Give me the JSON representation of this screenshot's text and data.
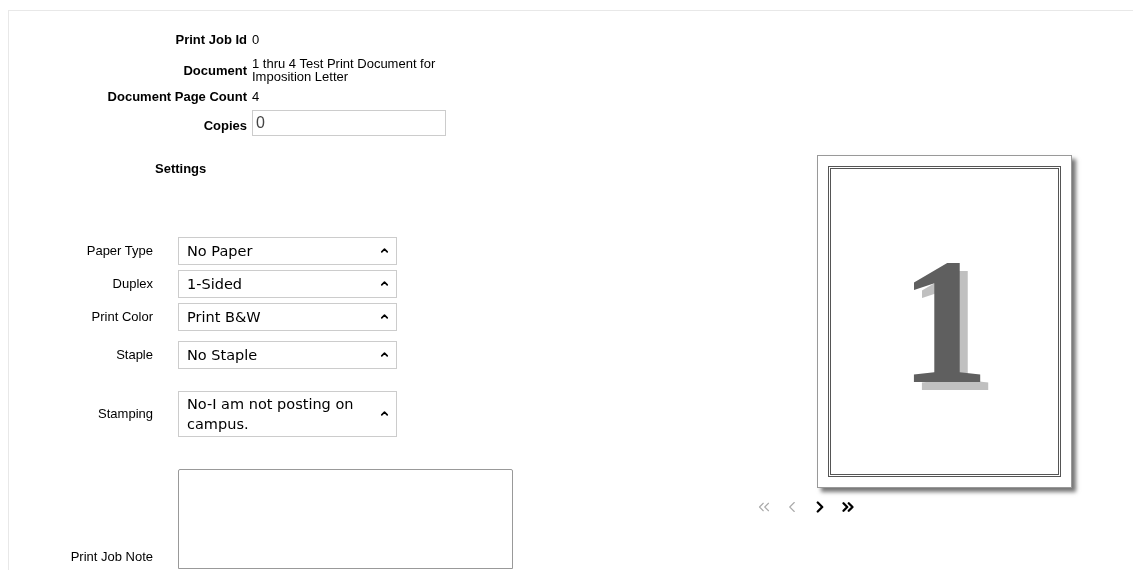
{
  "job_info": [
    {
      "label": "Print Job Id",
      "value": "0",
      "kind": "text"
    },
    {
      "label": "Document",
      "value": "1 thru 4 Test Print Document for Imposition Letter",
      "kind": "text"
    },
    {
      "label": "Document Page Count",
      "value": "4",
      "kind": "text"
    },
    {
      "label": "Copies",
      "value": "0",
      "kind": "input"
    }
  ],
  "settings_heading": "Settings",
  "settings": [
    {
      "label": "Paper Type",
      "value": "No Paper"
    },
    {
      "label": "Duplex",
      "value": "1-Sided"
    },
    {
      "label": "Print Color",
      "value": "Print B&W"
    },
    {
      "label": "Staple",
      "value": "No Staple"
    },
    {
      "label": "Stamping",
      "value": "No-I am not posting on campus."
    }
  ],
  "note": {
    "label": "Print Job Note"
  },
  "preview": {
    "page_number": "1",
    "nav": [
      {
        "kind": "first",
        "disabled": true
      },
      {
        "kind": "prev",
        "disabled": true
      },
      {
        "kind": "next",
        "disabled": false
      },
      {
        "kind": "last",
        "disabled": false
      }
    ]
  }
}
